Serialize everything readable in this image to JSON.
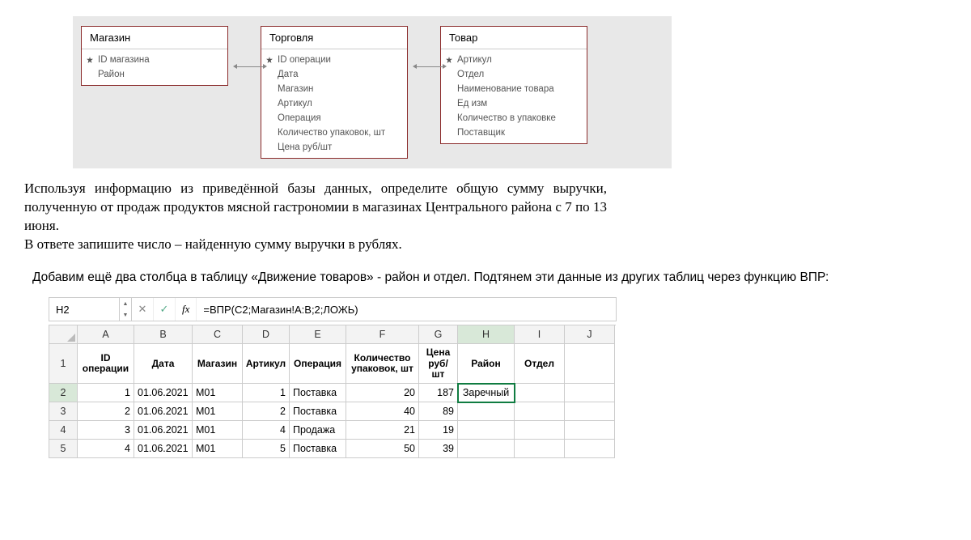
{
  "diagram": {
    "entities": [
      {
        "title": "Магазин",
        "fields": [
          {
            "name": "ID магазина",
            "pk": true
          },
          {
            "name": "Район",
            "pk": false
          }
        ]
      },
      {
        "title": "Торговля",
        "fields": [
          {
            "name": "ID операции",
            "pk": true
          },
          {
            "name": "Дата",
            "pk": false
          },
          {
            "name": "Магазин",
            "pk": false
          },
          {
            "name": "Артикул",
            "pk": false
          },
          {
            "name": "Операция",
            "pk": false
          },
          {
            "name": "Количество упаковок, шт",
            "pk": false
          },
          {
            "name": "Цена руб/шт",
            "pk": false
          }
        ]
      },
      {
        "title": "Товар",
        "fields": [
          {
            "name": "Артикул",
            "pk": true
          },
          {
            "name": "Отдел",
            "pk": false
          },
          {
            "name": "Наименование товара",
            "pk": false
          },
          {
            "name": "Ед изм",
            "pk": false
          },
          {
            "name": "Количество в упаковке",
            "pk": false
          },
          {
            "name": "Поставщик",
            "pk": false
          }
        ]
      }
    ]
  },
  "problem": {
    "p1": "Используя информацию из приведённой базы данных, определите общую сумму выручки, полученную от продаж продуктов мясной гастрономии в магазинах Центрального района с 7 по 13 июня.",
    "p2": "В ответе запишите число – найденную сумму выручки в рублях."
  },
  "instruction": "Добавим ещё два столбца в таблицу «Движение товаров» - район и отдел. Подтянем эти данные из других таблиц через функцию ВПР:",
  "formula_bar": {
    "cell_ref": "H2",
    "fx_label": "fx",
    "formula": "=ВПР(C2;Магазин!A:B;2;ЛОЖЬ)"
  },
  "grid": {
    "columns": [
      "A",
      "B",
      "C",
      "D",
      "E",
      "F",
      "G",
      "H",
      "I",
      "J"
    ],
    "row_numbers": [
      "1",
      "2",
      "3",
      "4",
      "5"
    ],
    "headers": [
      "ID операции",
      "Дата",
      "Магазин",
      "Артикул",
      "Операция",
      "Количество упаковок, шт",
      "Цена руб/ шт",
      "Район",
      "Отдел",
      ""
    ],
    "rows": [
      {
        "id": "1",
        "date": "01.06.2021",
        "store": "М01",
        "sku": "1",
        "op": "Поставка",
        "qty": "20",
        "price": "187",
        "rayon": "Заречный",
        "otdel": ""
      },
      {
        "id": "2",
        "date": "01.06.2021",
        "store": "М01",
        "sku": "2",
        "op": "Поставка",
        "qty": "40",
        "price": "89",
        "rayon": "",
        "otdel": ""
      },
      {
        "id": "3",
        "date": "01.06.2021",
        "store": "М01",
        "sku": "4",
        "op": "Продажа",
        "qty": "21",
        "price": "19",
        "rayon": "",
        "otdel": ""
      },
      {
        "id": "4",
        "date": "01.06.2021",
        "store": "М01",
        "sku": "5",
        "op": "Поставка",
        "qty": "50",
        "price": "39",
        "rayon": "",
        "otdel": ""
      }
    ],
    "active": {
      "row": 2,
      "col": "H"
    }
  }
}
